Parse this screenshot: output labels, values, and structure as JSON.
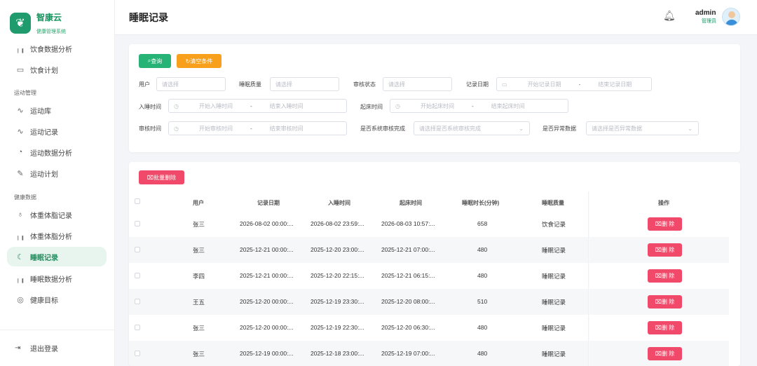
{
  "brand": {
    "title": "智康云",
    "subtitle": "健康管理系统"
  },
  "sidebar": {
    "items": [
      {
        "label": "饮食数据分析",
        "icon": "bar-chart-icon"
      },
      {
        "label": "饮食计划",
        "icon": "calendar-icon"
      },
      {
        "group": "运动管理"
      },
      {
        "label": "运动库",
        "icon": "pulse-icon"
      },
      {
        "label": "运动记录",
        "icon": "pulse-icon"
      },
      {
        "label": "运动数据分析",
        "icon": "pie-chart-icon"
      },
      {
        "label": "运动计划",
        "icon": "edit-icon"
      },
      {
        "group": "健康数据"
      },
      {
        "label": "体重体脂记录",
        "icon": "scale-icon"
      },
      {
        "label": "体重体脂分析",
        "icon": "bar-chart-icon"
      },
      {
        "label": "睡眠记录",
        "icon": "moon-icon",
        "active": true
      },
      {
        "label": "睡眠数据分析",
        "icon": "bar-chart-icon"
      },
      {
        "label": "健康目标",
        "icon": "target-icon"
      }
    ],
    "logout": "退出登录"
  },
  "header": {
    "title": "睡眠记录",
    "user": "admin",
    "role": "管理员"
  },
  "filters": {
    "query_label": "查询",
    "clear_label": "清空条件",
    "user": {
      "label": "用户",
      "placeholder": "请选择"
    },
    "quality": {
      "label": "睡眠质量",
      "placeholder": "请选择"
    },
    "audit_status": {
      "label": "审核状态",
      "placeholder": "请选择"
    },
    "record_date": {
      "label": "记录日期",
      "start": "开始记录日期",
      "end": "结束记录日期"
    },
    "sleep_time": {
      "label": "入睡时间",
      "start": "开始入睡时间",
      "end": "结束入睡时间"
    },
    "wake_time": {
      "label": "起床时间",
      "start": "开始起床时间",
      "end": "结束起床时间"
    },
    "audit_time": {
      "label": "审核时间",
      "start": "开始审核时间",
      "end": "结束审核时间"
    },
    "system_audit": {
      "label": "是否系统审核完成",
      "placeholder": "请选择是否系统审核完成"
    },
    "abnormal": {
      "label": "是否异常数据",
      "placeholder": "请选择是否异常数据"
    }
  },
  "table": {
    "batch_delete": "批量删除",
    "columns": [
      "用户",
      "记录日期",
      "入睡时间",
      "起床时间",
      "睡眠时长(分钟)",
      "睡眠质量",
      "操作"
    ],
    "delete_label": "删 除",
    "rows": [
      [
        "张三",
        "2026-08-02 00:00:...",
        "2026-08-02 23:59:...",
        "2026-08-03 10:57:...",
        "658",
        "饮食记录"
      ],
      [
        "张三",
        "2025-12-21 00:00:...",
        "2025-12-20 23:00:...",
        "2025-12-21 07:00:...",
        "480",
        "睡眠记录"
      ],
      [
        "李四",
        "2025-12-21 00:00:...",
        "2025-12-20 22:15:...",
        "2025-12-21 06:15:...",
        "480",
        "睡眠记录"
      ],
      [
        "王五",
        "2025-12-20 00:00:...",
        "2025-12-19 23:30:...",
        "2025-12-20 08:00:...",
        "510",
        "睡眠记录"
      ],
      [
        "张三",
        "2025-12-20 00:00:...",
        "2025-12-19 22:30:...",
        "2025-12-20 06:30:...",
        "480",
        "睡眠记录"
      ],
      [
        "张三",
        "2025-12-19 00:00:...",
        "2025-12-18 23:00:...",
        "2025-12-19 07:00:...",
        "480",
        "睡眠记录"
      ]
    ]
  },
  "colors": {
    "primary": "#27b376",
    "warning": "#f8a01c",
    "danger": "#f04969",
    "active_bg": "#e7f5ee"
  }
}
